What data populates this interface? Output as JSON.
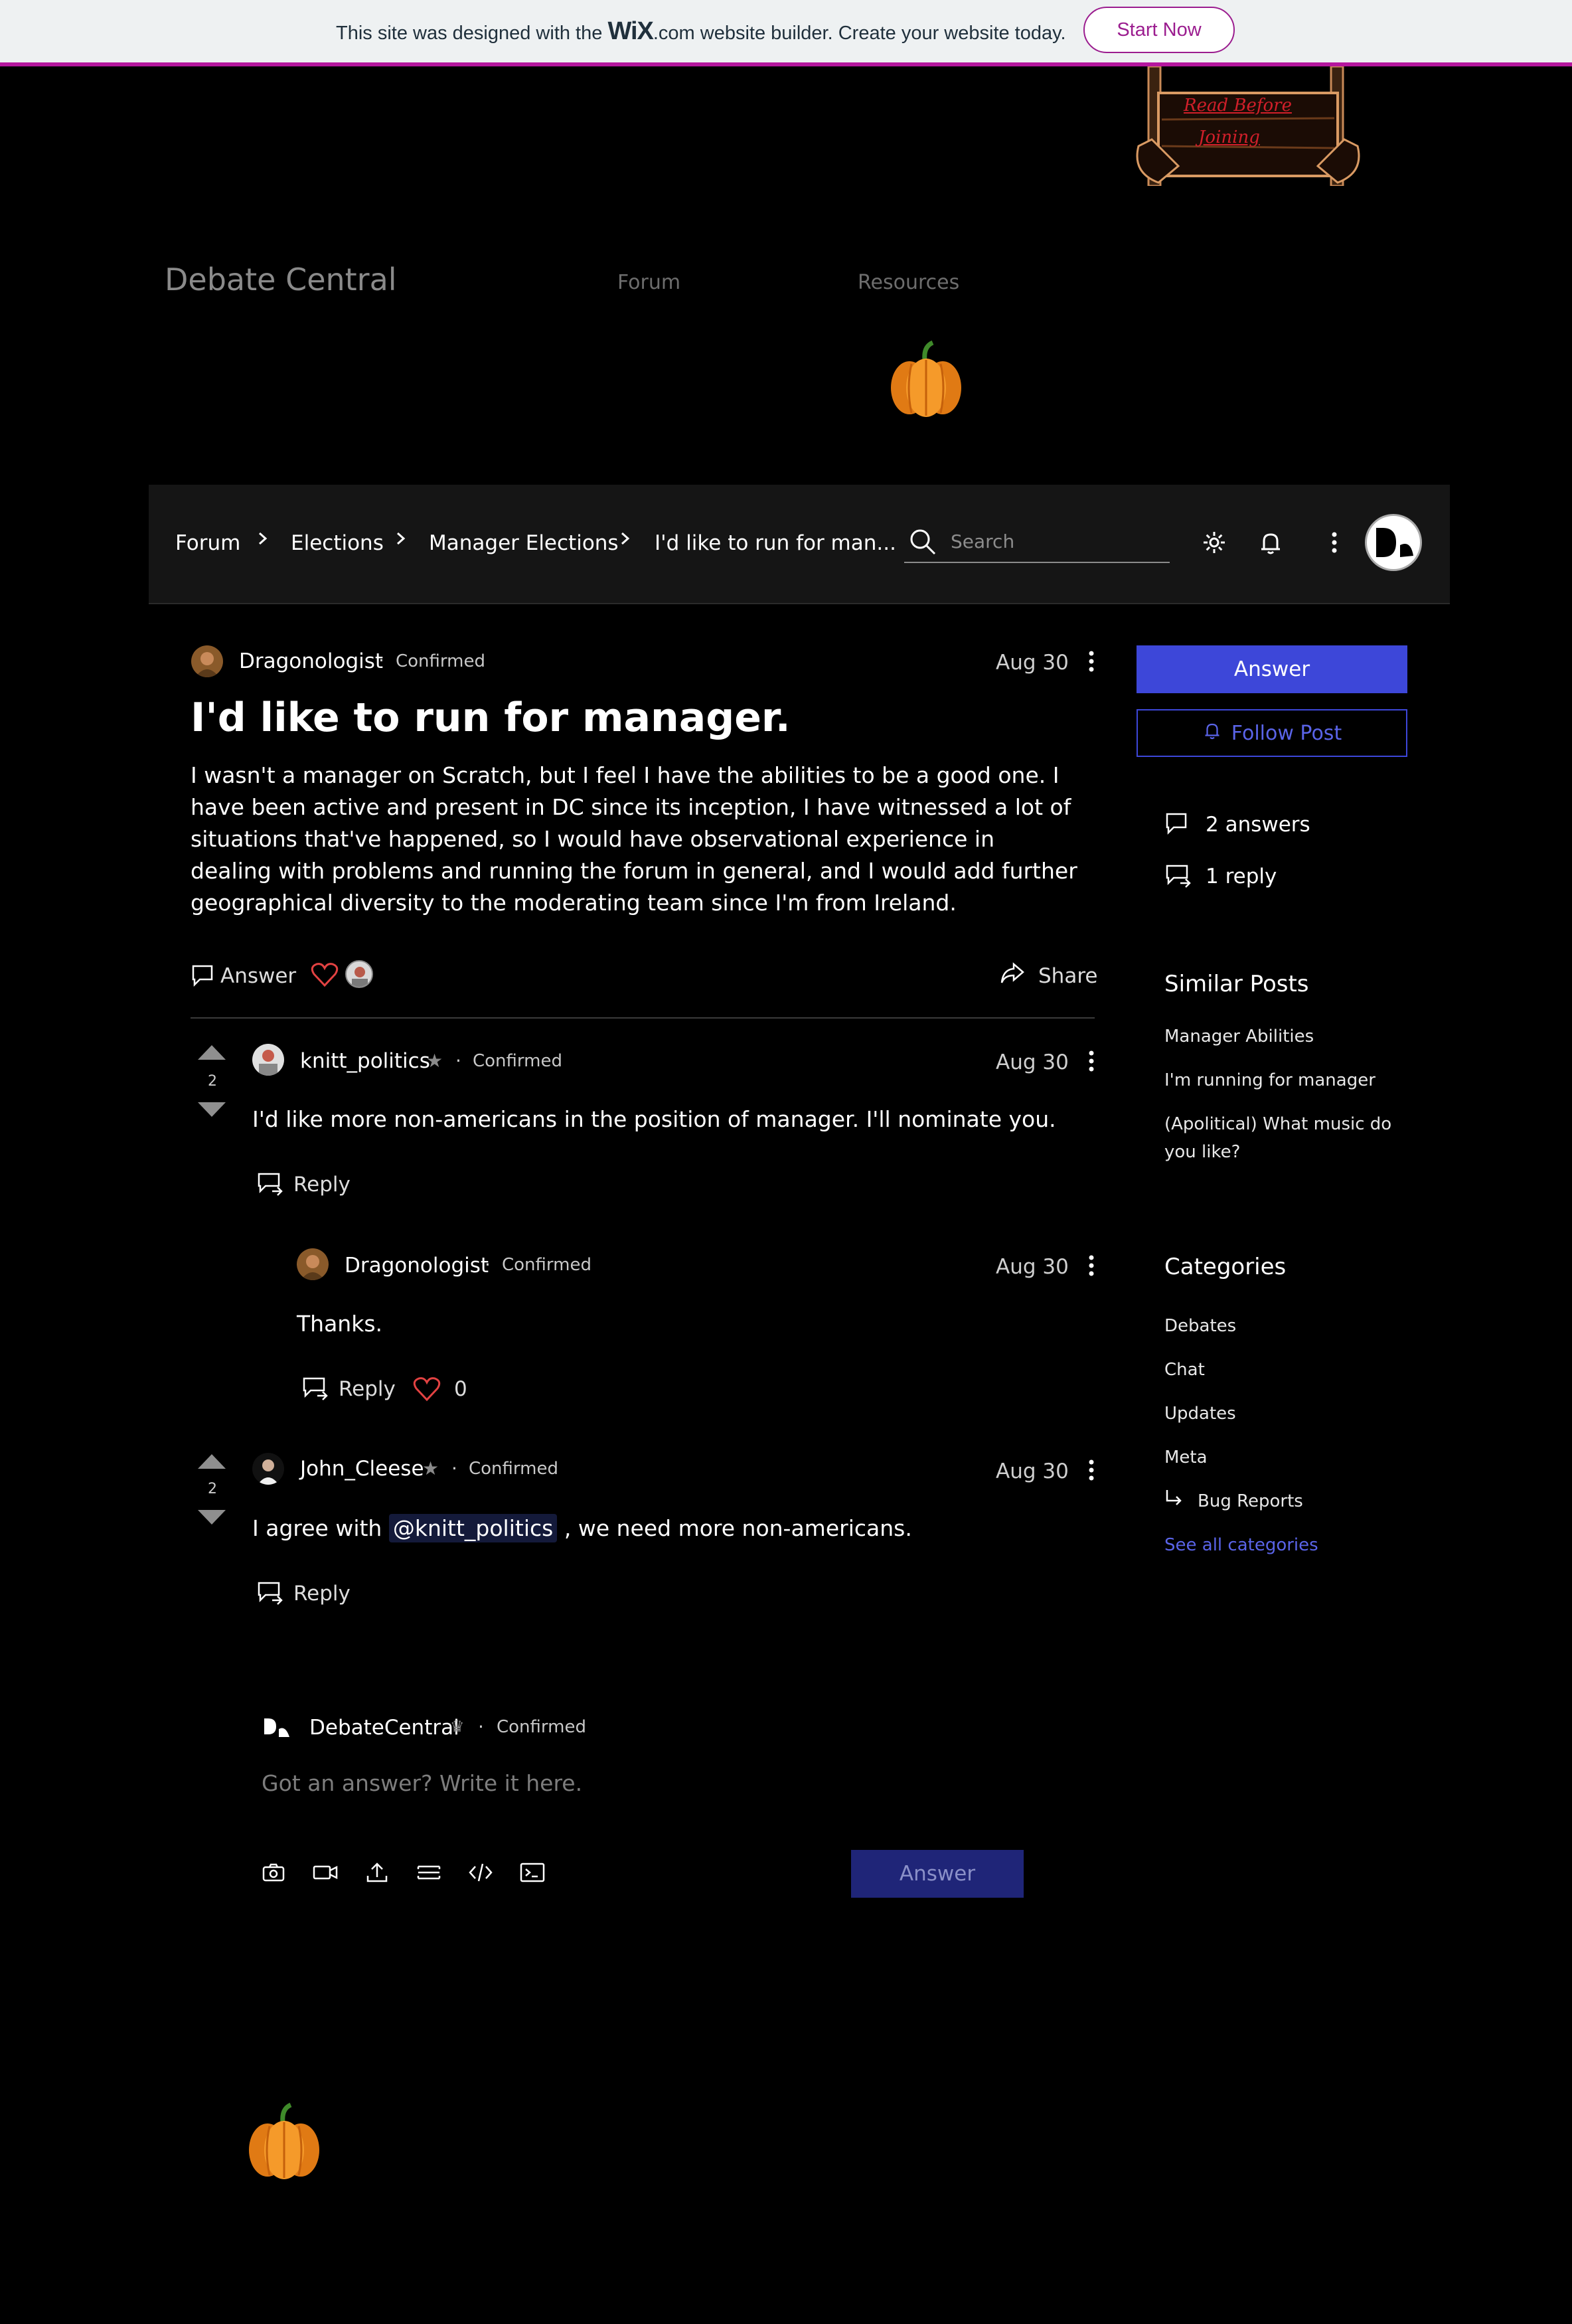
{
  "banner": {
    "text_before": "This site was designed with the",
    "logo": "WiX",
    "text_after": ".com website builder. Create your website today.",
    "cta": "Start Now"
  },
  "site": {
    "title": "Debate Central",
    "nav": [
      "Forum",
      "Resources"
    ],
    "sign_text": [
      "Read Before",
      "Joining"
    ]
  },
  "forum_bar": {
    "breadcrumbs": [
      "Forum",
      "Elections",
      "Manager Elections",
      "I'd like to run for man..."
    ],
    "search_placeholder": "Search"
  },
  "post": {
    "author": "Dragonologist",
    "status": "Confirmed",
    "date": "Aug 30",
    "title": "I'd like to run for manager.",
    "body": "I wasn't a manager on Scratch, but I feel I have the abilities to be a good one. I have been active and present in DC since its inception, I have witnessed a lot of situations that've happened, so I would have observational experience in dealing with problems and running the forum in general, and I would add further geographical diversity to the moderating team since I'm from Ireland.",
    "answer_label": "Answer",
    "share_label": "Share"
  },
  "answers": [
    {
      "author": "knitt_politics",
      "status": "Confirmed",
      "date": "Aug 30",
      "votes": "2",
      "text": "I'd like more non-americans in the position of manager. I'll nominate you.",
      "reply_label": "Reply",
      "replies": [
        {
          "author": "Dragonologist",
          "status": "Confirmed",
          "date": "Aug 30",
          "text": "Thanks.",
          "reply_label": "Reply",
          "likes": "0"
        }
      ]
    },
    {
      "author": "John_Cleese",
      "status": "Confirmed",
      "date": "Aug 30",
      "votes": "2",
      "text_before": "I agree with",
      "mention": "@knitt_politics",
      "text_after": ", we need more non-americans.",
      "reply_label": "Reply"
    }
  ],
  "composer": {
    "author": "DebateCentral",
    "status": "Confirmed",
    "placeholder": "Got an answer? Write it here.",
    "submit": "Answer"
  },
  "sidebar": {
    "answer_button": "Answer",
    "follow_button": "Follow Post",
    "stats": [
      "2 answers",
      "1 reply"
    ],
    "similar_heading": "Similar Posts",
    "similar": [
      "Manager Abilities",
      "I'm running for manager",
      "(Apolitical) What music do",
      "you like?"
    ],
    "categories_heading": "Categories",
    "categories": [
      "Debates",
      "Chat",
      "Updates",
      "Meta",
      "Bug Reports"
    ],
    "see_all": "See all categories"
  },
  "colors": {
    "accent": "#3d47d9",
    "accent_dim": "#1f2578",
    "banner_border": "#b5179e",
    "like": "#e34242"
  }
}
